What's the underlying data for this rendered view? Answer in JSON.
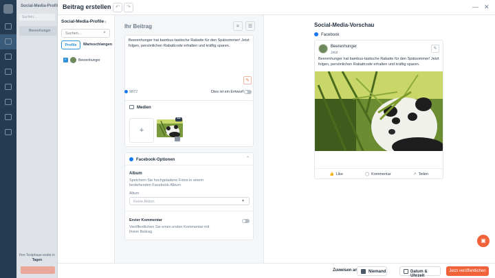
{
  "app": {
    "brand_color": "#f0623a",
    "accent_color": "#2e8fd6",
    "background_panel": {
      "title": "Social-Media-Profile",
      "search_placeholder": "Suchen...",
      "profile_name": "Beerenhunger",
      "promo_line1": "Ihre Testphase endet in",
      "promo_line2": "Tagen"
    }
  },
  "modal": {
    "title": "Beitrag erstellen",
    "header_icons": [
      "undo-icon",
      "redo-icon",
      "minimize-icon",
      "close-icon"
    ]
  },
  "profiles": {
    "title": "Social-Media-Profile",
    "search_placeholder": "Suchen...",
    "tabs": [
      "Profile",
      "Warteschlangen"
    ],
    "items": [
      {
        "name": "Beerenhunger",
        "checked": true
      }
    ]
  },
  "editor": {
    "title": "Ihr Beitrag",
    "text": "Beerenhunger hat bambus-tastische Rabatte für den Spätsommer! Jetzt folgen, persönlichen Rabattcode erhalten und kräftig sparen.",
    "char_count": "9872",
    "draft_label": "Dies ist ein Entwurf",
    "media_title": "Medien",
    "fb_options_title": "Facebook-Optionen",
    "album_label": "Album",
    "album_desc": "Speichern Sie hochgeladene Fotos in einem bestehenden Facebook-Album",
    "album_field_label": "Album",
    "album_placeholder": "Keine Aktion",
    "first_comment_label": "Erster Kommentar",
    "first_comment_desc": "Veröffentlichen Sie einen ersten Kommentar mit Ihrem Beitrag"
  },
  "preview": {
    "title": "Social-Media-Vorschau",
    "network": "Facebook",
    "profile_name": "Beerenhunger",
    "time": "Jetzt",
    "text": "Beerenhunger hat bambus-tastische Rabatte für den Spätsommer! Jetzt folgen, persönlichen Rabattcode erhalten und kräftig sparen.",
    "actions": [
      "Like",
      "Kommentar",
      "Teilen"
    ]
  },
  "footer": {
    "assign_label": "Zuweisen an",
    "assignee": "Niemand",
    "date_button": "Datum & Uhrzeit",
    "publish_button": "Jetzt veröffentlichen"
  }
}
